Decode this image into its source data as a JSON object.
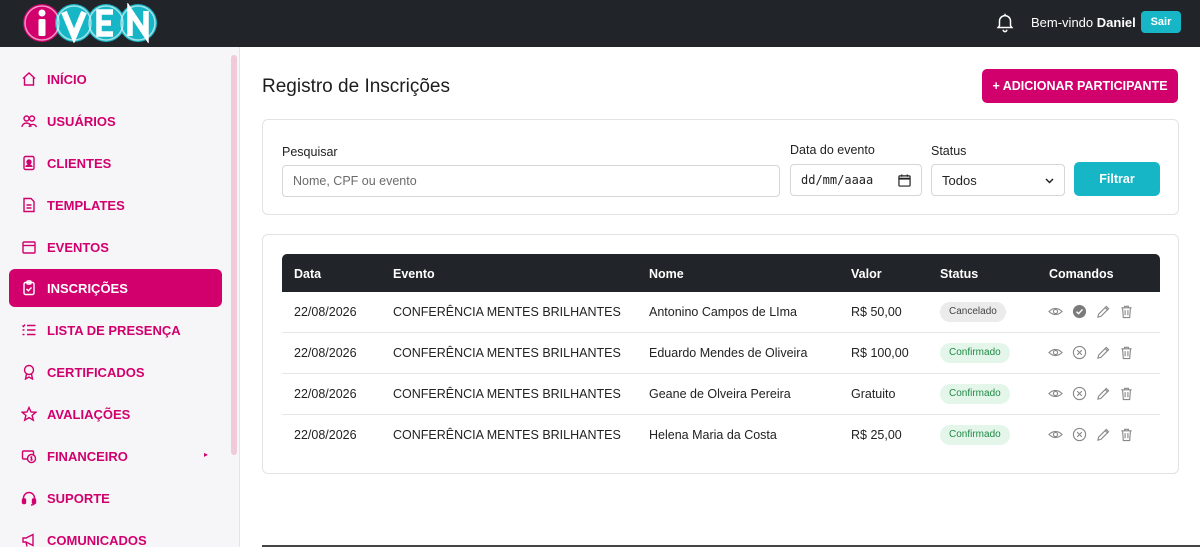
{
  "header": {
    "logo_text": "iVEN",
    "welcome_prefix": "Bem-vindo",
    "user_name": "Daniel",
    "logout_label": "Sair",
    "accent_color": "#d1006d",
    "secondary_color": "#17b6c6"
  },
  "sidebar": {
    "items": [
      {
        "label": "INÍCIO",
        "icon": "home-icon"
      },
      {
        "label": "USUÁRIOS",
        "icon": "users-icon"
      },
      {
        "label": "CLIENTES",
        "icon": "id-badge-icon"
      },
      {
        "label": "TEMPLATES",
        "icon": "document-icon"
      },
      {
        "label": "EVENTOS",
        "icon": "calendar-icon"
      },
      {
        "label": "INSCRIÇÕES",
        "icon": "clipboard-icon",
        "active": true
      },
      {
        "label": "LISTA DE PRESENÇA",
        "icon": "checklist-icon"
      },
      {
        "label": "CERTIFICADOS",
        "icon": "award-icon"
      },
      {
        "label": "AVALIAÇÕES",
        "icon": "star-icon"
      },
      {
        "label": "FINANCEIRO",
        "icon": "money-icon",
        "submenu": true
      },
      {
        "label": "SUPORTE",
        "icon": "headset-icon"
      },
      {
        "label": "COMUNICADOS",
        "icon": "megaphone-icon"
      }
    ]
  },
  "main": {
    "title": "Registro de Inscrições",
    "add_button": "+ ADICIONAR PARTICIPANTE"
  },
  "filters": {
    "search_label": "Pesquisar",
    "search_placeholder": "Nome, CPF ou evento",
    "date_label": "Data do evento",
    "date_placeholder": "dd/mm/aaaa",
    "status_label": "Status",
    "status_selected": "Todos",
    "filter_button": "Filtrar"
  },
  "table": {
    "columns": [
      "Data",
      "Evento",
      "Nome",
      "Valor",
      "Status",
      "Comandos"
    ],
    "rows": [
      {
        "date": "22/08/2026",
        "event": "CONFERÊNCIA MENTES BRILHANTES",
        "name": "Antonino Campos de LIma",
        "value": "R$ 50,00",
        "status": "Cancelado"
      },
      {
        "date": "22/08/2026",
        "event": "CONFERÊNCIA MENTES BRILHANTES",
        "name": "Eduardo Mendes de Oliveira",
        "value": "R$ 100,00",
        "status": "Confirmado"
      },
      {
        "date": "22/08/2026",
        "event": "CONFERÊNCIA MENTES BRILHANTES",
        "name": "Geane de Olveira Pereira",
        "value": "Gratuito",
        "status": "Confirmado"
      },
      {
        "date": "22/08/2026",
        "event": "CONFERÊNCIA MENTES BRILHANTES",
        "name": "Helena Maria da Costa",
        "value": "R$ 25,00",
        "status": "Confirmado"
      }
    ]
  }
}
